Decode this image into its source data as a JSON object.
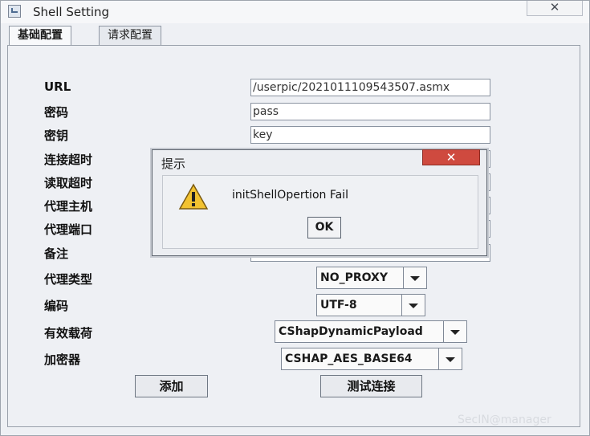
{
  "window": {
    "title": "Shell Setting",
    "close_symbol": "✕"
  },
  "tabs": [
    {
      "label": "基础配置",
      "active": true
    },
    {
      "label": "请求配置",
      "active": false
    }
  ],
  "form": {
    "url_label": "URL",
    "url_value": "/userpic/2021011109543507.asmx",
    "password_label": "密码",
    "password_value": "pass",
    "key_label": "密钥",
    "key_value": "key",
    "connect_timeout_label": "连接超时",
    "read_timeout_label": "读取超时",
    "proxy_host_label": "代理主机",
    "proxy_port_label": "代理端口",
    "remark_label": "备注",
    "proxy_type_label": "代理类型",
    "proxy_type_value": "NO_PROXY",
    "encoding_label": "编码",
    "encoding_value": "UTF-8",
    "payload_label": "有效载荷",
    "payload_value": "CShapDynamicPayload",
    "cryption_label": "加密器",
    "cryption_value": "CSHAP_AES_BASE64",
    "add_button": "添加",
    "test_button": "测试连接"
  },
  "dialog": {
    "title": "提示",
    "close_symbol": "✕",
    "message": "initShellOpertion Fail",
    "ok_button": "OK"
  },
  "watermark": "SecIN@manager"
}
